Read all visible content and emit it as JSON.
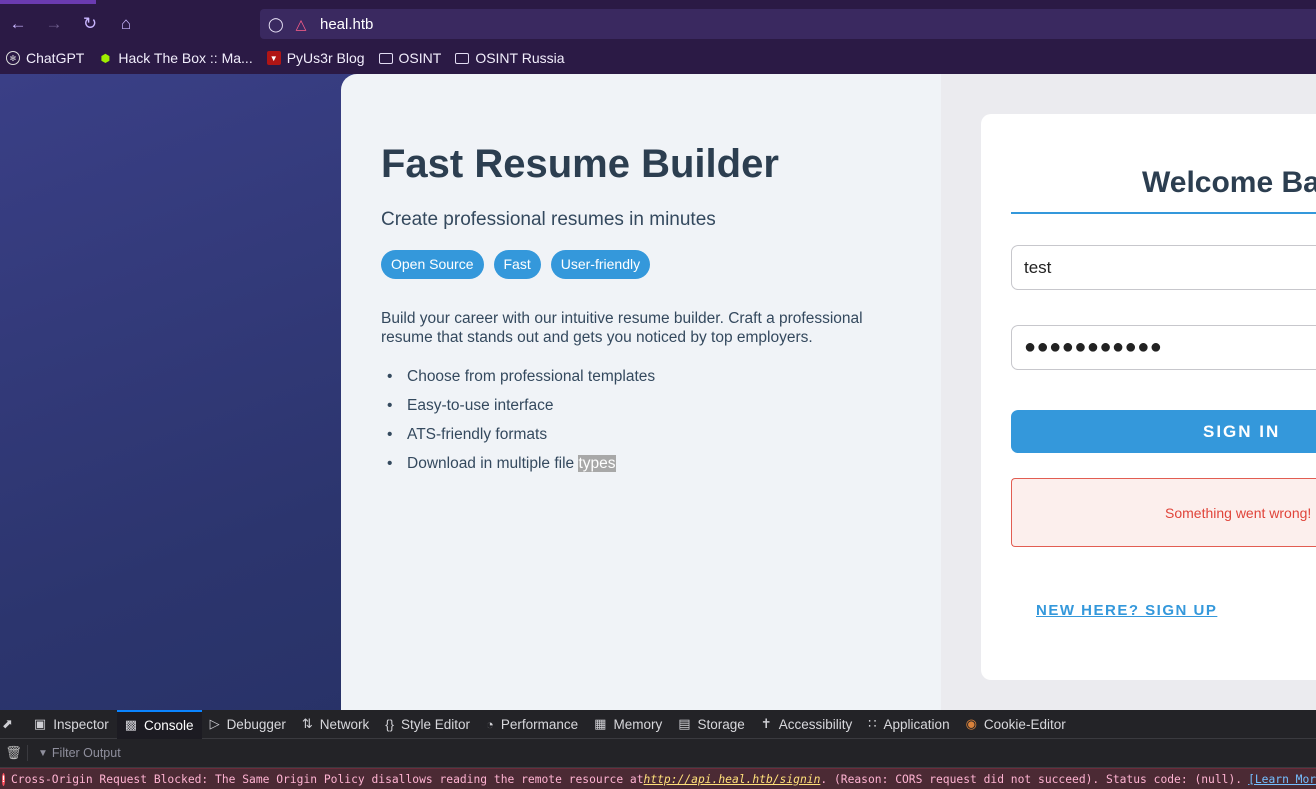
{
  "browser": {
    "url": "heal.htb",
    "bookmarks": [
      {
        "label": "ChatGPT",
        "icon": "chatgpt-icon"
      },
      {
        "label": "Hack The Box :: Ma...",
        "icon": "htb-icon"
      },
      {
        "label": "PyUs3r Blog",
        "icon": "pyus3r-icon"
      },
      {
        "label": "OSINT",
        "icon": "folder-icon"
      },
      {
        "label": "OSINT Russia",
        "icon": "folder-icon"
      }
    ]
  },
  "hero": {
    "title": "Fast Resume Builder",
    "subtitle": "Create professional resumes in minutes",
    "tags": [
      "Open Source",
      "Fast",
      "User-friendly"
    ],
    "description": "Build your career with our intuitive resume builder. Craft a professional resume that stands out and gets you noticed by top employers.",
    "features": [
      "Choose from professional templates",
      "Easy-to-use interface",
      "ATS-friendly formats"
    ],
    "last_feature_prefix": "Download in multiple file ",
    "last_feature_selected": "types"
  },
  "login": {
    "title": "Welcome Bac",
    "username_value": "test",
    "password_masked": "●●●●●●●●●●●",
    "signin_label": "SIGN IN",
    "error_message": "Something went wrong!",
    "signup_link": "NEW HERE? SIGN UP"
  },
  "devtools": {
    "tabs": [
      "Inspector",
      "Console",
      "Debugger",
      "Network",
      "Style Editor",
      "Performance",
      "Memory",
      "Storage",
      "Accessibility",
      "Application",
      "Cookie-Editor"
    ],
    "active_tab": "Console",
    "filter_placeholder": "Filter Output",
    "error": {
      "prefix": "Cross-Origin Request Blocked: The Same Origin Policy disallows reading the remote resource at ",
      "url": "http://api.heal.htb/signin",
      "suffix": ". (Reason: CORS request did not succeed). Status code: (null).",
      "learn_more": "[Learn More]"
    }
  },
  "colors": {
    "accent": "#3498db",
    "title": "#2c3e50",
    "error": "#e0443a",
    "chrome": "#2b1a45"
  }
}
